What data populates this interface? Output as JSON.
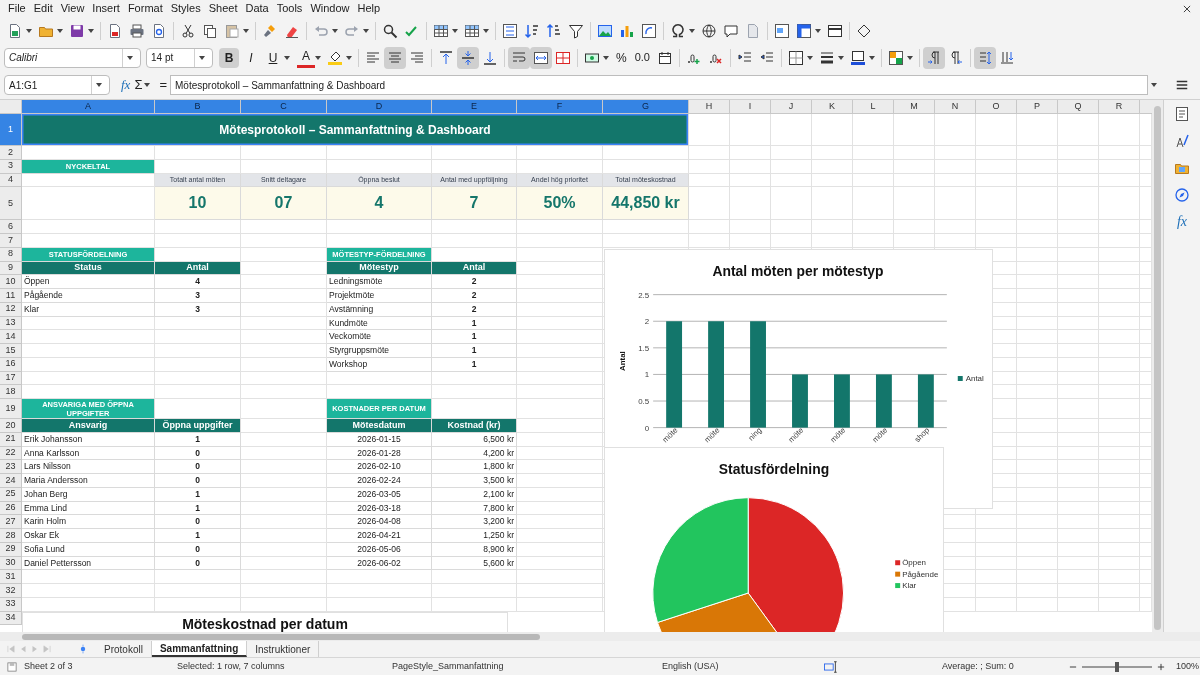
{
  "menu": [
    "File",
    "Edit",
    "View",
    "Insert",
    "Format",
    "Styles",
    "Sheet",
    "Data",
    "Tools",
    "Window",
    "Help"
  ],
  "format_bar": {
    "font_name": "Calibri",
    "font_size": "14 pt",
    "styles": [
      {
        "glyph": "B",
        "kind": "bold",
        "selected": true
      },
      {
        "glyph": "I",
        "kind": "italic",
        "selected": false
      },
      {
        "glyph": "U",
        "kind": "underline",
        "selected": false
      }
    ],
    "font_color_glyph": "A",
    "halign": [
      {
        "selected": false
      },
      {
        "selected": true
      },
      {
        "selected": false
      }
    ],
    "valign": [
      {
        "selected": false
      },
      {
        "selected": true
      },
      {
        "selected": false
      }
    ],
    "wrap_text": true,
    "merge_cells": true,
    "percent_glyph": "%",
    "decimal_glyph": "0.0"
  },
  "formula_bar": {
    "name_box": "A1:G1",
    "glyphs": [
      "fx",
      "Σ",
      "="
    ],
    "formula": "Mötesprotokoll – Sammanfattning & Dashboard"
  },
  "columns": [
    {
      "label": "A",
      "selected": true
    },
    {
      "label": "B",
      "selected": true
    },
    {
      "label": "C",
      "selected": true
    },
    {
      "label": "D",
      "selected": true
    },
    {
      "label": "E",
      "selected": true
    },
    {
      "label": "F",
      "selected": true
    },
    {
      "label": "G",
      "selected": true
    },
    {
      "label": "H",
      "selected": false
    },
    {
      "label": "I",
      "selected": false
    },
    {
      "label": "J",
      "selected": false
    },
    {
      "label": "K",
      "selected": false
    },
    {
      "label": "L",
      "selected": false
    },
    {
      "label": "M",
      "selected": false
    },
    {
      "label": "N",
      "selected": false
    },
    {
      "label": "O",
      "selected": false
    },
    {
      "label": "P",
      "selected": false
    },
    {
      "label": "Q",
      "selected": false
    },
    {
      "label": "R",
      "selected": false
    }
  ],
  "rows": [
    {
      "label": "1",
      "selected": true,
      "cells": [
        {
          "kind": "title",
          "text": "Mötesprotokoll – Sammanfattning & Dashboard"
        }
      ]
    },
    {
      "label": "2",
      "selected": false
    },
    {
      "label": "3",
      "selected": false,
      "cells": [
        {
          "kind": "section",
          "text": "NYCKELTAL"
        }
      ]
    },
    {
      "label": "4",
      "selected": false,
      "cells": [
        {
          "kind": "blank"
        },
        {
          "kind": "kpi_label",
          "text": "Totalt antal möten"
        },
        {
          "kind": "kpi_label",
          "text": "Snitt deltagare"
        },
        {
          "kind": "kpi_label",
          "text": "Öppna beslut"
        },
        {
          "kind": "kpi_label",
          "text": "Antal med uppföljning"
        },
        {
          "kind": "kpi_label",
          "text": "Andel hög prioritet"
        },
        {
          "kind": "kpi_label",
          "text": "Total möteskostnad"
        }
      ]
    },
    {
      "label": "5",
      "selected": false,
      "cells": [
        {
          "kind": "blank"
        },
        {
          "kind": "kpi_value",
          "text": "10"
        },
        {
          "kind": "kpi_value",
          "text": "07"
        },
        {
          "kind": "kpi_value",
          "text": "4"
        },
        {
          "kind": "kpi_value",
          "text": "7"
        },
        {
          "kind": "kpi_value",
          "text": "50%"
        },
        {
          "kind": "kpi_value",
          "text": "44,850 kr"
        }
      ]
    },
    {
      "label": "6",
      "selected": false
    },
    {
      "label": "7",
      "selected": false
    },
    {
      "label": "8",
      "selected": false,
      "cells": [
        {
          "kind": "section",
          "text": "STATUSFÖRDELNING"
        },
        {
          "kind": "blank"
        },
        {
          "kind": "blank"
        },
        {
          "kind": "section",
          "text": "MÖTESTYP-FÖRDELNING"
        }
      ]
    },
    {
      "label": "9",
      "selected": false,
      "cells": [
        {
          "kind": "header",
          "text": "Status"
        },
        {
          "kind": "header",
          "text": "Antal"
        },
        {
          "kind": "blank"
        },
        {
          "kind": "header",
          "text": "Mötestyp"
        },
        {
          "kind": "header",
          "text": "Antal"
        }
      ]
    },
    {
      "label": "10",
      "selected": false,
      "cells": [
        {
          "kind": "text",
          "text": "Öppen"
        },
        {
          "kind": "number",
          "text": "4"
        },
        {
          "kind": "blank"
        },
        {
          "kind": "text",
          "text": "Ledningsmöte"
        },
        {
          "kind": "number",
          "text": "2"
        }
      ]
    },
    {
      "label": "11",
      "selected": false,
      "cells": [
        {
          "kind": "text",
          "text": "Pågående"
        },
        {
          "kind": "number",
          "text": "3"
        },
        {
          "kind": "blank"
        },
        {
          "kind": "text",
          "text": "Projektmöte"
        },
        {
          "kind": "number",
          "text": "2"
        }
      ]
    },
    {
      "label": "12",
      "selected": false,
      "cells": [
        {
          "kind": "text",
          "text": "Klar"
        },
        {
          "kind": "number",
          "text": "3"
        },
        {
          "kind": "blank"
        },
        {
          "kind": "text",
          "text": "Avstämning"
        },
        {
          "kind": "number",
          "text": "2"
        }
      ]
    },
    {
      "label": "13",
      "selected": false,
      "cells": [
        {
          "kind": "blank"
        },
        {
          "kind": "blank"
        },
        {
          "kind": "blank"
        },
        {
          "kind": "text",
          "text": "Kundmöte"
        },
        {
          "kind": "number",
          "text": "1"
        }
      ]
    },
    {
      "label": "14",
      "selected": false,
      "cells": [
        {
          "kind": "blank"
        },
        {
          "kind": "blank"
        },
        {
          "kind": "blank"
        },
        {
          "kind": "text",
          "text": "Veckomöte"
        },
        {
          "kind": "number",
          "text": "1"
        }
      ]
    },
    {
      "label": "15",
      "selected": false,
      "cells": [
        {
          "kind": "blank"
        },
        {
          "kind": "blank"
        },
        {
          "kind": "blank"
        },
        {
          "kind": "text",
          "text": "Styrgruppsmöte"
        },
        {
          "kind": "number",
          "text": "1"
        }
      ]
    },
    {
      "label": "16",
      "selected": false,
      "cells": [
        {
          "kind": "blank"
        },
        {
          "kind": "blank"
        },
        {
          "kind": "blank"
        },
        {
          "kind": "text",
          "text": "Workshop"
        },
        {
          "kind": "number",
          "text": "1"
        }
      ]
    },
    {
      "label": "17",
      "selected": false
    },
    {
      "label": "18",
      "selected": false
    },
    {
      "label": "19",
      "selected": false,
      "cells": [
        {
          "kind": "section",
          "text": "ANSVARIGA MED ÖPPNA UPPGIFTER"
        },
        {
          "kind": "blank"
        },
        {
          "kind": "blank"
        },
        {
          "kind": "section",
          "text": "KOSTNADER PER DATUM"
        }
      ]
    },
    {
      "label": "20",
      "selected": false,
      "cells": [
        {
          "kind": "header",
          "text": "Ansvarig"
        },
        {
          "kind": "header",
          "text": "Öppna uppgifter"
        },
        {
          "kind": "blank"
        },
        {
          "kind": "header",
          "text": "Mötesdatum"
        },
        {
          "kind": "header",
          "text": "Kostnad (kr)"
        }
      ]
    },
    {
      "label": "21",
      "selected": false,
      "cells": [
        {
          "kind": "text",
          "text": "Erik Johansson"
        },
        {
          "kind": "number",
          "text": "1"
        },
        {
          "kind": "blank"
        },
        {
          "kind": "date",
          "text": "2026-01-15"
        },
        {
          "kind": "amount",
          "text": "6,500 kr"
        }
      ]
    },
    {
      "label": "22",
      "selected": false,
      "cells": [
        {
          "kind": "text",
          "text": "Anna Karlsson"
        },
        {
          "kind": "number",
          "text": "0"
        },
        {
          "kind": "blank"
        },
        {
          "kind": "date",
          "text": "2026-01-28"
        },
        {
          "kind": "amount",
          "text": "4,200 kr"
        }
      ]
    },
    {
      "label": "23",
      "selected": false,
      "cells": [
        {
          "kind": "text",
          "text": "Lars Nilsson"
        },
        {
          "kind": "number",
          "text": "0"
        },
        {
          "kind": "blank"
        },
        {
          "kind": "date",
          "text": "2026-02-10"
        },
        {
          "kind": "amount",
          "text": "1,800 kr"
        }
      ]
    },
    {
      "label": "24",
      "selected": false,
      "cells": [
        {
          "kind": "text",
          "text": "Maria Andersson"
        },
        {
          "kind": "number",
          "text": "0"
        },
        {
          "kind": "blank"
        },
        {
          "kind": "date",
          "text": "2026-02-24"
        },
        {
          "kind": "amount",
          "text": "3,500 kr"
        }
      ]
    },
    {
      "label": "25",
      "selected": false,
      "cells": [
        {
          "kind": "text",
          "text": "Johan Berg"
        },
        {
          "kind": "number",
          "text": "1"
        },
        {
          "kind": "blank"
        },
        {
          "kind": "date",
          "text": "2026-03-05"
        },
        {
          "kind": "amount",
          "text": "2,100 kr"
        }
      ]
    },
    {
      "label": "26",
      "selected": false,
      "cells": [
        {
          "kind": "text",
          "text": "Emma Lind"
        },
        {
          "kind": "number",
          "text": "1"
        },
        {
          "kind": "blank"
        },
        {
          "kind": "date",
          "text": "2026-03-18"
        },
        {
          "kind": "amount",
          "text": "7,800 kr"
        }
      ]
    },
    {
      "label": "27",
      "selected": false,
      "cells": [
        {
          "kind": "text",
          "text": "Karin Holm"
        },
        {
          "kind": "number",
          "text": "0"
        },
        {
          "kind": "blank"
        },
        {
          "kind": "date",
          "text": "2026-04-08"
        },
        {
          "kind": "amount",
          "text": "3,200 kr"
        }
      ]
    },
    {
      "label": "28",
      "selected": false,
      "cells": [
        {
          "kind": "text",
          "text": "Oskar Ek"
        },
        {
          "kind": "number",
          "text": "1"
        },
        {
          "kind": "blank"
        },
        {
          "kind": "date",
          "text": "2026-04-21"
        },
        {
          "kind": "amount",
          "text": "1,250 kr"
        }
      ]
    },
    {
      "label": "29",
      "selected": false,
      "cells": [
        {
          "kind": "text",
          "text": "Sofia Lund"
        },
        {
          "kind": "number",
          "text": "0"
        },
        {
          "kind": "blank"
        },
        {
          "kind": "date",
          "text": "2026-05-06"
        },
        {
          "kind": "amount",
          "text": "8,900 kr"
        }
      ]
    },
    {
      "label": "30",
      "selected": false,
      "cells": [
        {
          "kind": "text",
          "text": "Daniel Pettersson"
        },
        {
          "kind": "number",
          "text": "0"
        },
        {
          "kind": "blank"
        },
        {
          "kind": "date",
          "text": "2026-06-02"
        },
        {
          "kind": "amount",
          "text": "5,600 kr"
        }
      ]
    },
    {
      "label": "31",
      "selected": false
    },
    {
      "label": "32",
      "selected": false
    },
    {
      "label": "33",
      "selected": false
    },
    {
      "label": "34",
      "selected": false
    }
  ],
  "charts": [
    {
      "chart_data": {
        "type": "bar",
        "title": "Antal möten per mötestyp",
        "ylabel": "Antal",
        "categories": [
          "möte",
          "möte",
          "ning",
          "möte",
          "möte",
          "möte",
          "shop"
        ],
        "series": [
          {
            "name": "Antal",
            "color": "#13766b",
            "values": [
              2,
              2,
              2,
              1,
              1,
              1,
              1
            ]
          }
        ],
        "ylim": [
          0,
          2.5
        ],
        "yticks": [
          0,
          0.5,
          1,
          1.5,
          2,
          2.5
        ],
        "grid": true,
        "legend": "right"
      }
    },
    {
      "chart_data": {
        "type": "pie",
        "title": "Statusfördelning",
        "categories": [
          "Öppen",
          "Pågående",
          "Klar"
        ],
        "values": [
          40,
          30,
          30
        ],
        "legend": "right"
      },
      "slices": [
        {
          "color": "#dc2626"
        },
        {
          "color": "#d97706"
        },
        {
          "color": "#22c55e"
        }
      ]
    },
    {
      "kind": "title_only",
      "title": "Möteskostnad per datum"
    }
  ],
  "sidebar": {
    "function_glyph": "fx"
  },
  "sheet_tabs": [
    {
      "label": "Protokoll",
      "selected": false
    },
    {
      "label": "Sammanfattning",
      "selected": true
    },
    {
      "label": "Instruktioner",
      "selected": false
    }
  ],
  "status_bar": {
    "sheet": "Sheet 2 of 3",
    "selection": "Selected: 1 row, 7 columns",
    "page_style": "PageStyle_Sammanfattning",
    "language": "English (USA)",
    "summary": "Average: ; Sum: 0",
    "zoom": {
      "level": 0.5,
      "reading": "100%"
    }
  }
}
